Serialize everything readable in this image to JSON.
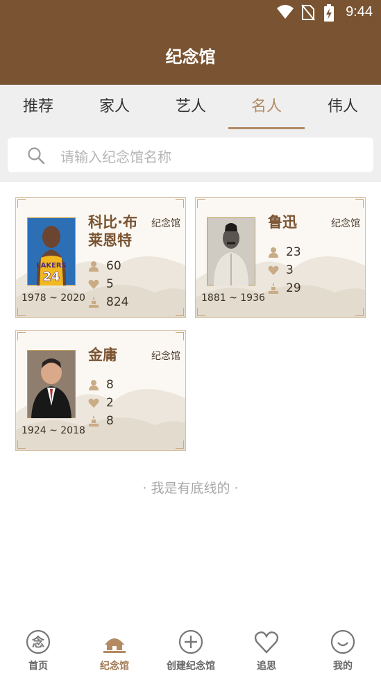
{
  "status": {
    "time": "9:44"
  },
  "header": {
    "title": "纪念馆"
  },
  "tabs": [
    {
      "label": "推荐",
      "active": false
    },
    {
      "label": "家人",
      "active": false
    },
    {
      "label": "艺人",
      "active": false
    },
    {
      "label": "名人",
      "active": true
    },
    {
      "label": "伟人",
      "active": false
    }
  ],
  "search": {
    "placeholder": "请输入纪念馆名称"
  },
  "cards": [
    {
      "name": "科比·布莱恩特",
      "tag": "纪念馆",
      "visitors": "60",
      "likes": "5",
      "offerings": "824",
      "dates": "1978 ~ 2020"
    },
    {
      "name": "鲁迅",
      "tag": "纪念馆",
      "visitors": "23",
      "likes": "3",
      "offerings": "29",
      "dates": "1881 ~ 1936"
    },
    {
      "name": "金庸",
      "tag": "纪念馆",
      "visitors": "8",
      "likes": "2",
      "offerings": "8",
      "dates": "1924 ~ 2018"
    }
  ],
  "footer_note": "· 我是有底线的 ·",
  "nav": [
    {
      "label": "首页",
      "icon": "nian-icon",
      "active": false
    },
    {
      "label": "纪念馆",
      "icon": "hall-icon",
      "active": true
    },
    {
      "label": "创建纪念馆",
      "icon": "plus-circle-icon",
      "active": false
    },
    {
      "label": "追思",
      "icon": "heart-icon",
      "active": false
    },
    {
      "label": "我的",
      "icon": "smile-icon",
      "active": false
    }
  ],
  "colors": {
    "brand": "#7a5432",
    "accent": "#b48a63",
    "tab_bg": "#efefef"
  }
}
